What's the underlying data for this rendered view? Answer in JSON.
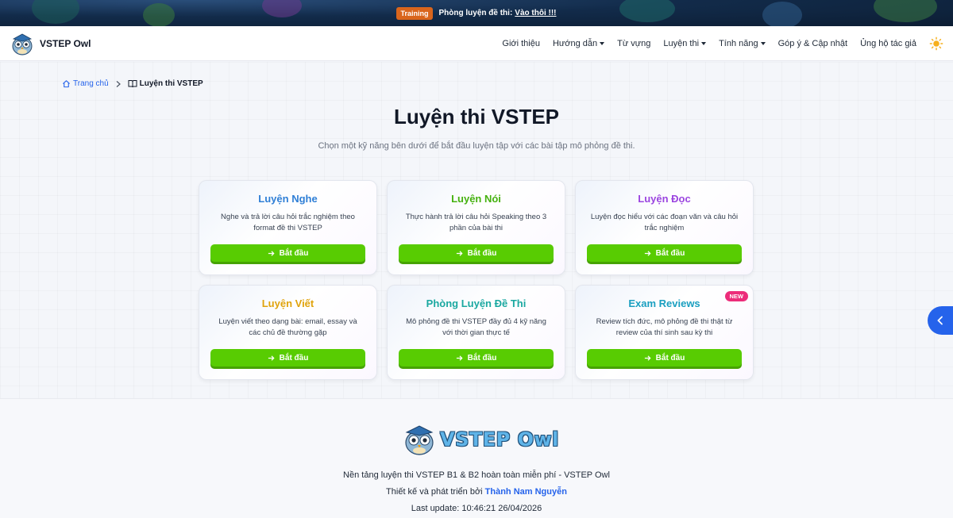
{
  "banner": {
    "badge": "Training",
    "text": "Phòng luyện đề thi:",
    "link": "Vào thôi !!!"
  },
  "navbar": {
    "brand": "VSTEP Owl",
    "items": [
      {
        "label": "Giới thiệu",
        "dropdown": false
      },
      {
        "label": "Hướng dẫn",
        "dropdown": true
      },
      {
        "label": "Từ vựng",
        "dropdown": false
      },
      {
        "label": "Luyện thi",
        "dropdown": true
      },
      {
        "label": "Tính năng",
        "dropdown": true
      },
      {
        "label": "Góp ý & Cập nhật",
        "dropdown": false
      },
      {
        "label": "Ủng hộ tác giả",
        "dropdown": false
      }
    ]
  },
  "breadcrumb": {
    "home": "Trang chủ",
    "current": "Luyện thi VSTEP"
  },
  "page": {
    "title": "Luyện thi VSTEP",
    "subtitle": "Chọn một kỹ năng bên dưới để bắt đầu luyện tập với các bài tập mô phỏng đề thi."
  },
  "cards": [
    {
      "title": "Luyện Nghe",
      "color": "#2f7fd6",
      "desc": "Nghe và trả lời câu hỏi trắc nghiệm theo format đề thi VSTEP",
      "button": "Bắt đầu",
      "badge": ""
    },
    {
      "title": "Luyện Nói",
      "color": "#45b10f",
      "desc": "Thực hành trả lời câu hỏi Speaking theo 3 phần của bài thi",
      "button": "Bắt đầu",
      "badge": ""
    },
    {
      "title": "Luyện Đọc",
      "color": "#9b45e0",
      "desc": "Luyện đọc hiểu với các đoạn văn và câu hỏi trắc nghiệm",
      "button": "Bắt đầu",
      "badge": ""
    },
    {
      "title": "Luyện Viết",
      "color": "#e0a30c",
      "desc": "Luyện viết theo dạng bài: email, essay và các chủ đề thường gặp",
      "button": "Bắt đầu",
      "badge": ""
    },
    {
      "title": "Phòng Luyện Đề Thi",
      "color": "#1aa8a0",
      "desc": "Mô phỏng đề thi VSTEP đầy đủ 4 kỹ năng với thời gian thực tế",
      "button": "Bắt đầu",
      "badge": ""
    },
    {
      "title": "Exam Reviews",
      "color": "#1a9fc0",
      "desc": "Review tích đức, mô phỏng đề thi thật từ review của thí sinh sau kỳ thi",
      "button": "Bắt đầu",
      "badge": "NEW"
    }
  ],
  "footer": {
    "logo_text": "VSTEP Owl",
    "line1": "Nền tảng luyện thi VSTEP B1 & B2 hoàn toàn miễn phí - VSTEP Owl",
    "line2_prefix": "Thiết kế và phát triển bởi ",
    "author": "Thành Nam Nguyễn",
    "line3": "Last update: 10:46:21 26/04/2026"
  },
  "colors": {
    "accent": "#2563eb",
    "button_green": "#58cc02",
    "badge_new": "#ec2c7a",
    "training_badge": "#d9651c"
  },
  "icons": [
    "home-icon",
    "chevron-right-icon",
    "book-icon",
    "arrow-right-icon",
    "sun-icon",
    "chevron-left-icon",
    "owl-logo-icon"
  ]
}
